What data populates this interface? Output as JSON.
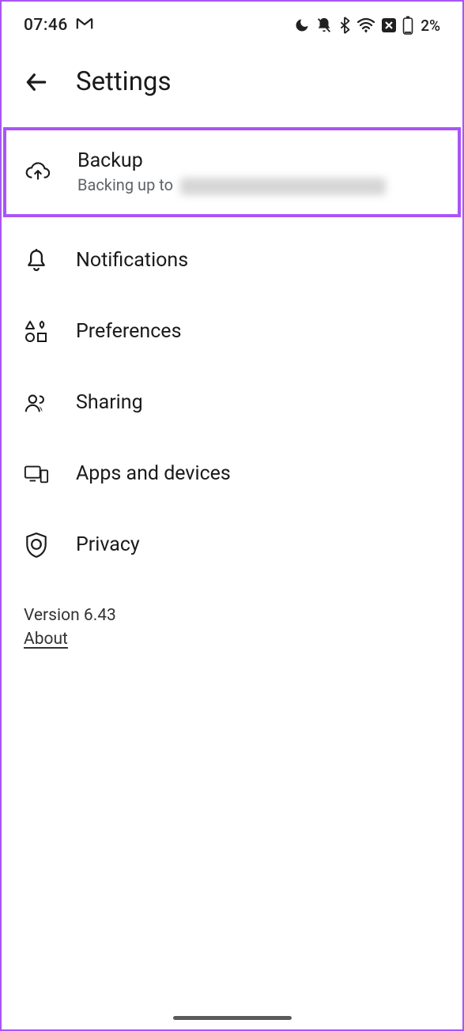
{
  "status": {
    "time": "07:46",
    "gmail": "M",
    "battery": "2%"
  },
  "header": {
    "title": "Settings"
  },
  "items": {
    "backup": {
      "title": "Backup",
      "subtitle_prefix": "Backing up to "
    },
    "notifications": {
      "title": "Notifications"
    },
    "preferences": {
      "title": "Preferences"
    },
    "sharing": {
      "title": "Sharing"
    },
    "apps": {
      "title": "Apps and devices"
    },
    "privacy": {
      "title": "Privacy"
    }
  },
  "footer": {
    "version": "Version 6.43",
    "about": "About"
  }
}
